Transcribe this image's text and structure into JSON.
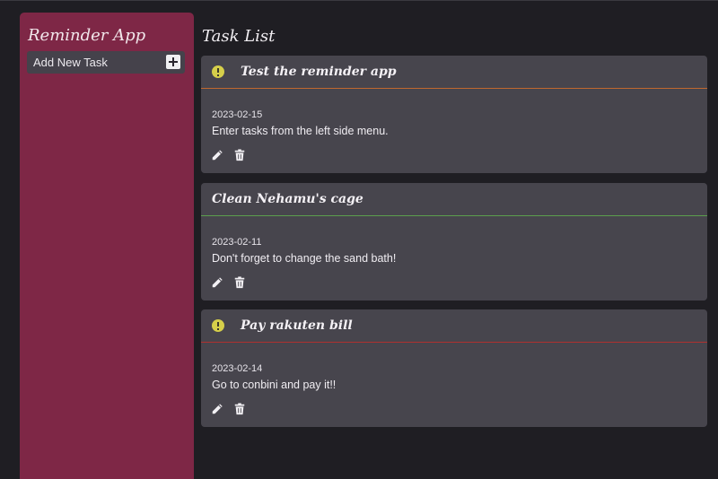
{
  "sidebar": {
    "title": "Reminder App",
    "add_task_label": "Add New Task"
  },
  "main": {
    "title": "Task List"
  },
  "tasks": [
    {
      "title": "Test the reminder app",
      "date": "2023-02-15",
      "description": "Enter tasks from the left side menu.",
      "alert": true,
      "accent_color": "#c0682f"
    },
    {
      "title": "Clean Nehamu's cage",
      "date": "2023-02-11",
      "description": "Don't forget to change the sand bath!",
      "alert": false,
      "accent_color": "#5b9e4d"
    },
    {
      "title": "Pay rakuten bill",
      "date": "2023-02-14",
      "description": "Go to conbini and pay it!!",
      "alert": true,
      "accent_color": "#b0302f"
    }
  ],
  "icons": {
    "alert": "exclamation-circle-icon",
    "add": "plus-icon",
    "edit": "pencil-icon",
    "delete": "trash-icon"
  },
  "colors": {
    "sidebar_bg": "#7e2746",
    "page_bg": "#1f1e23",
    "card_bg": "#47454d",
    "alert_icon": "#d6cf4a"
  }
}
